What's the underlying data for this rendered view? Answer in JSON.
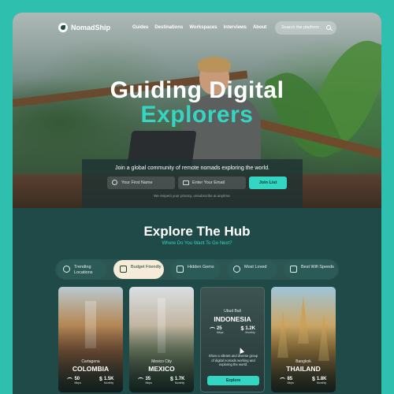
{
  "brand": {
    "name": "NomadShip"
  },
  "nav": {
    "links": [
      "Guides",
      "Destinations",
      "Workspaces",
      "Interviews",
      "About"
    ],
    "search_placeholder": "Search the platform"
  },
  "hero": {
    "title_line1": "Guiding Digital",
    "title_line2": "Explorers"
  },
  "join": {
    "tagline": "Join a global community of remote nomads exploring the world.",
    "first_name_placeholder": "Your First Name",
    "email_placeholder": "Enter Your Email",
    "button": "Join List",
    "privacy": "We respect your privacy, unsubscribe at anytime."
  },
  "hub": {
    "title": "Explore The Hub",
    "subtitle": "Where Do You Want To Go Next?",
    "filters": [
      {
        "label": "Trending Locations",
        "active": false,
        "icon": "fire-icon"
      },
      {
        "label": "Budget Friendly",
        "active": true,
        "icon": "hand-coins-icon"
      },
      {
        "label": "Hidden Gems",
        "active": false,
        "icon": "gem-icon"
      },
      {
        "label": "Most Loved",
        "active": false,
        "icon": "heart-icon"
      },
      {
        "label": "Best Wifi Speeds",
        "active": false,
        "icon": "laptop-icon"
      }
    ]
  },
  "cards": [
    {
      "city": "Cartagena",
      "country": "COLOMBIA",
      "wifi": "50",
      "wifi_unit": "Mbps",
      "cost": "1.5K",
      "cost_unit": "Monthly"
    },
    {
      "city": "Mexico City",
      "country": "MEXICO",
      "wifi": "35",
      "wifi_unit": "Mbps",
      "cost": "1.7K",
      "cost_unit": "Monthly"
    },
    {
      "city": "Ubud Bali",
      "country": "INDONESIA",
      "wifi": "25",
      "wifi_unit": "Mbps",
      "cost": "1.2K",
      "cost_unit": "Monthly",
      "description": "Show a vibrant and diverse group of digital nomads working and exploring the world.",
      "button": "Explore"
    },
    {
      "city": "Bangkok",
      "country": "THAILAND",
      "wifi": "85",
      "wifi_unit": "Mbps",
      "cost": "1.8K",
      "cost_unit": "Monthly"
    }
  ],
  "colors": {
    "accent": "#33d6c2",
    "panel": "#1f4a47",
    "border": "#2fbfae",
    "active_filter": "#f4ecd8"
  }
}
